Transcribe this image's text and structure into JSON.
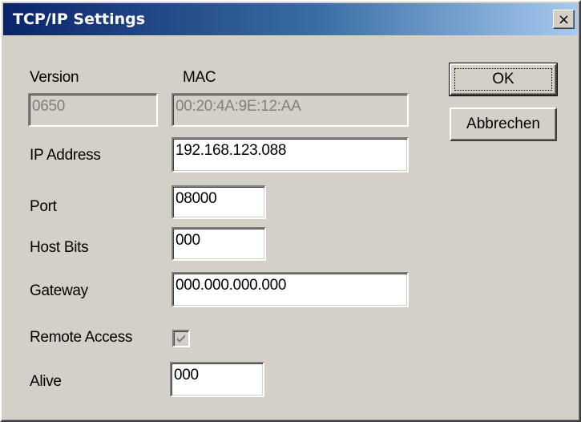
{
  "window": {
    "title": "TCP/IP Settings",
    "close_glyph": "×"
  },
  "labels": {
    "version": "Version",
    "mac": "MAC",
    "ip_address": "IP Address",
    "port": "Port",
    "host_bits": "Host Bits",
    "gateway": "Gateway",
    "remote_access": "Remote Access",
    "alive": "Alive"
  },
  "values": {
    "version": "0650",
    "mac": "00:20:4A:9E:12:AA",
    "ip_address": "192.168.123.088",
    "port": "08000",
    "host_bits": "000",
    "gateway": "000.000.000.000",
    "alive": "000"
  },
  "remote_access": {
    "checked": true,
    "enabled": false
  },
  "buttons": {
    "ok": "OK",
    "cancel": "Abbrechen"
  },
  "colors": {
    "face": "#d4d0c8",
    "title_start": "#0a246a",
    "title_end": "#a6caf0"
  }
}
